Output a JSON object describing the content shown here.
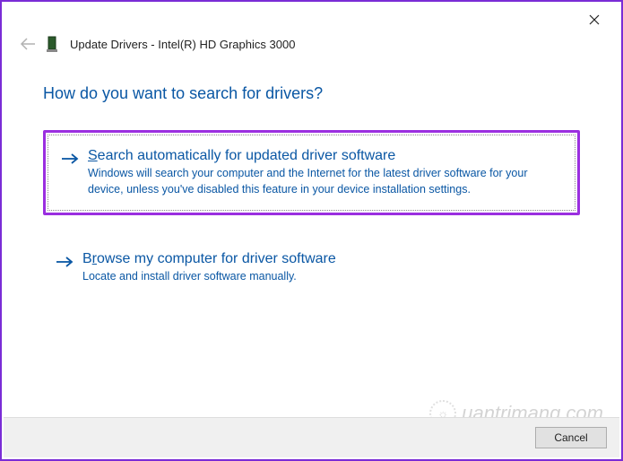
{
  "window": {
    "title": "Update Drivers - Intel(R) HD Graphics 3000"
  },
  "heading": "How do you want to search for drivers?",
  "options": {
    "search_auto": {
      "title_pre": "S",
      "title_rest": "earch automatically for updated driver software",
      "desc": "Windows will search your computer and the Internet for the latest driver software for your device, unless you've disabled this feature in your device installation settings."
    },
    "browse": {
      "title_pre": "B",
      "title_mid": "r",
      "title_rest": "owse my computer for driver software",
      "desc": "Locate and install driver software manually."
    }
  },
  "buttons": {
    "cancel": "Cancel"
  },
  "watermark": "uantrimang.com"
}
